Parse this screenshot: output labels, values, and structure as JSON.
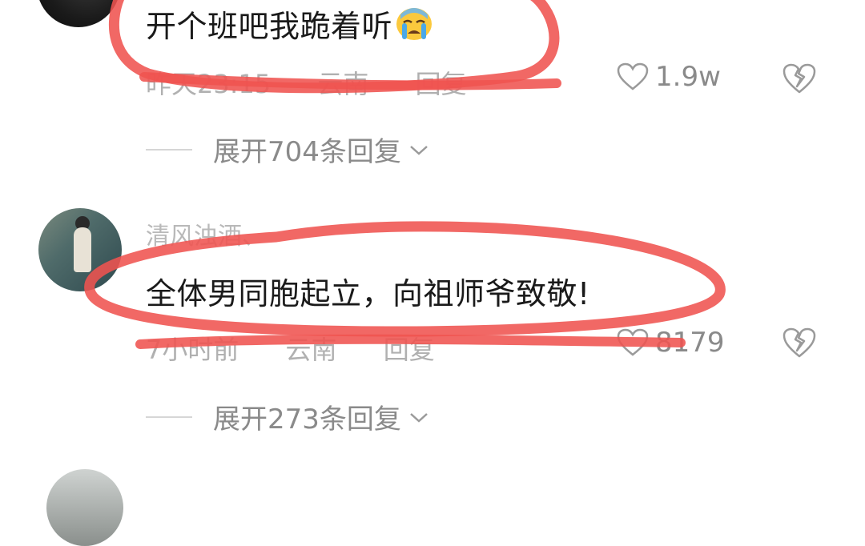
{
  "comments": [
    {
      "text": "开个班吧我跪着听",
      "emoji": "loudly-crying-face",
      "time": "昨天23:15",
      "location": "云南",
      "reply_label": "回复",
      "likes": "1.9w",
      "expand_label": "展开704条回复"
    },
    {
      "username": "清风浊酒、",
      "text": "全体男同胞起立，向祖师爷致敬!",
      "time": "7小时前",
      "location": "云南",
      "reply_label": "回复",
      "likes": "8179",
      "expand_label": "展开273条回复"
    }
  ],
  "colors": {
    "annotation_stroke": "#ef5350",
    "text_primary": "#1a1a1a",
    "text_secondary": "#b0b0b0",
    "icon_gray": "#9a9a9a"
  },
  "icons": {
    "like": "heart-outline-icon",
    "dislike": "broken-heart-icon",
    "expand": "chevron-down-icon"
  }
}
